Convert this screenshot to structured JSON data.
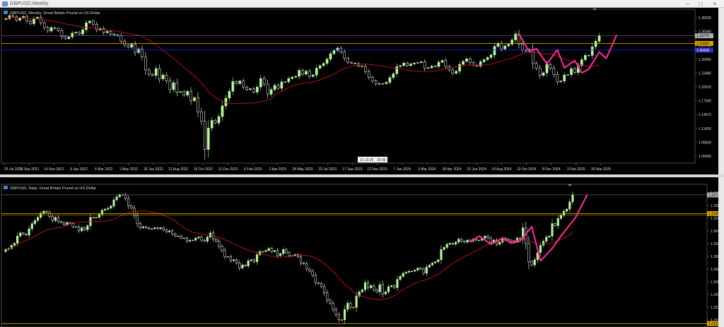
{
  "app": {
    "top_window_title": "GBPUSD,Weekly",
    "bottom_window_title": "GBPUSD,Daily"
  },
  "colors": {
    "background": "#000000",
    "bull_candle": "#b8f5a2",
    "bear_candle": "#ffffff",
    "moving_average": "#c01818",
    "annotation": "#e8308c",
    "h_line": "#d4a000",
    "bid_line": "#2020d8"
  },
  "chart_data": [
    {
      "type": "candlestick",
      "title": "GBPUSD, Weekly:  Great Britain Pound vs US Dollar",
      "x_ticks": [
        "25 Jul 2021",
        "19 Sep 2021",
        "14 Nov 2021",
        "9 Jan 2022",
        "6 Mar 2022",
        "1 May 2022",
        "26 Jun 2022",
        "21 Aug 2022",
        "16 Oct 2022",
        "11 Dec 2022",
        "5 Feb 2023",
        "2 Apr 2023",
        "28 May 2023",
        "23 Jul 2023",
        "17 Sep 2023",
        "12 Nov 2023",
        "7 Jan 2024",
        "3 Mar 2024",
        "28 Apr 2024",
        "23 Jun 2024",
        "18 Aug 2024",
        "13 Oct 2024",
        "8 Dec 2024",
        "2 Feb 2025",
        "30 Mar 2025"
      ],
      "y_ticks": [
        "1.38330",
        "1.35360",
        "1.29450",
        "1.26450",
        "1.23480",
        "1.20510",
        "1.17540",
        "1.14570",
        "1.11600",
        "1.08630",
        "1.05660"
      ],
      "price_labels": {
        "current": "1.33776",
        "h_line": "1.32005",
        "bid": "1.30426"
      },
      "cursor_label": {
        "date": "21.10.20",
        "time": "20:00"
      },
      "ylim": [
        1.04,
        1.4
      ],
      "ma_period": "",
      "closes": [
        1.378,
        1.385,
        1.382,
        1.374,
        1.379,
        1.383,
        1.372,
        1.366,
        1.378,
        1.381,
        1.368,
        1.357,
        1.349,
        1.357,
        1.355,
        1.35,
        1.336,
        1.331,
        1.335,
        1.344,
        1.346,
        1.342,
        1.352,
        1.368,
        1.372,
        1.365,
        1.352,
        1.355,
        1.345,
        1.348,
        1.342,
        1.34,
        1.338,
        1.325,
        1.316,
        1.311,
        1.318,
        1.299,
        1.307,
        1.288,
        1.258,
        1.248,
        1.245,
        1.261,
        1.237,
        1.246,
        1.232,
        1.212,
        1.228,
        1.206,
        1.207,
        1.199,
        1.208,
        1.186,
        1.193,
        1.16,
        1.138,
        1.072,
        1.122,
        1.14,
        1.134,
        1.149,
        1.174,
        1.192,
        1.208,
        1.231,
        1.226,
        1.232,
        1.218,
        1.212,
        1.214,
        1.206,
        1.218,
        1.238,
        1.225,
        1.201,
        1.212,
        1.222,
        1.215,
        1.23,
        1.23,
        1.238,
        1.241,
        1.243,
        1.257,
        1.248,
        1.255,
        1.243,
        1.246,
        1.262,
        1.268,
        1.273,
        1.283,
        1.296,
        1.303,
        1.309,
        1.3,
        1.285,
        1.276,
        1.274,
        1.273,
        1.267,
        1.267,
        1.254,
        1.241,
        1.232,
        1.225,
        1.226,
        1.226,
        1.229,
        1.24,
        1.249,
        1.266,
        1.268,
        1.274,
        1.268,
        1.272,
        1.274,
        1.275,
        1.277,
        1.262,
        1.263,
        1.267,
        1.266,
        1.276,
        1.28,
        1.266,
        1.258,
        1.25,
        1.255,
        1.271,
        1.278,
        1.284,
        1.275,
        1.269,
        1.267,
        1.277,
        1.282,
        1.287,
        1.293,
        1.313,
        1.32,
        1.307,
        1.314,
        1.318,
        1.328,
        1.342,
        1.318,
        1.305,
        1.302,
        1.306,
        1.273,
        1.262,
        1.245,
        1.251,
        1.271,
        1.262,
        1.247,
        1.23,
        1.232,
        1.246,
        1.247,
        1.261,
        1.252,
        1.268,
        1.282,
        1.292,
        1.292,
        1.312,
        1.325,
        1.338
      ]
    },
    {
      "type": "candlestick",
      "title": "GBPUSD, Daily:  Great Britain Pound vs US Dollar",
      "y_ticks": [
        "1.34078",
        "1.32868",
        "1.31698",
        "1.30440",
        "1.29230",
        "1.28020",
        "1.26810",
        "1.25600",
        "1.24390",
        "1.23100",
        "1.21970"
      ],
      "price_labels": {
        "current": "1.33776",
        "h_line_top": "1.31968",
        "h_line_bottom": "1.21329"
      },
      "ylim": [
        1.21,
        1.348
      ],
      "closes": [
        1.285,
        1.286,
        1.289,
        1.291,
        1.298,
        1.301,
        1.3,
        1.299,
        1.305,
        1.31,
        1.313,
        1.316,
        1.32,
        1.322,
        1.321,
        1.317,
        1.313,
        1.316,
        1.312,
        1.311,
        1.309,
        1.311,
        1.31,
        1.307,
        1.307,
        1.303,
        1.306,
        1.304,
        1.308,
        1.316,
        1.316,
        1.316,
        1.319,
        1.323,
        1.324,
        1.325,
        1.327,
        1.333,
        1.336,
        1.338,
        1.338,
        1.334,
        1.327,
        1.325,
        1.318,
        1.31,
        1.306,
        1.307,
        1.306,
        1.305,
        1.305,
        1.306,
        1.305,
        1.306,
        1.304,
        1.302,
        1.303,
        1.3,
        1.298,
        1.298,
        1.296,
        1.296,
        1.293,
        1.294,
        1.294,
        1.296,
        1.297,
        1.294,
        1.293,
        1.297,
        1.301,
        1.295,
        1.293,
        1.288,
        1.284,
        1.278,
        1.278,
        1.274,
        1.275,
        1.272,
        1.267,
        1.27,
        1.269,
        1.274,
        1.275,
        1.273,
        1.28,
        1.283,
        1.283,
        1.284,
        1.286,
        1.283,
        1.284,
        1.279,
        1.281,
        1.285,
        1.282,
        1.279,
        1.279,
        1.28,
        1.278,
        1.272,
        1.271,
        1.266,
        1.264,
        1.26,
        1.253,
        1.252,
        1.249,
        1.243,
        1.236,
        1.233,
        1.227,
        1.222,
        1.217,
        1.217,
        1.227,
        1.233,
        1.229,
        1.229,
        1.24,
        1.244,
        1.246,
        1.253,
        1.248,
        1.25,
        1.246,
        1.244,
        1.251,
        1.242,
        1.244,
        1.249,
        1.25,
        1.248,
        1.256,
        1.259,
        1.262,
        1.263,
        1.264,
        1.264,
        1.265,
        1.267,
        1.266,
        1.262,
        1.268,
        1.27,
        1.272,
        1.273,
        1.275,
        1.285,
        1.287,
        1.29,
        1.291,
        1.29,
        1.292,
        1.295,
        1.293,
        1.292,
        1.294,
        1.293,
        1.295,
        1.294,
        1.294,
        1.296,
        1.298,
        1.296,
        1.292,
        1.294,
        1.29,
        1.292,
        1.296,
        1.295,
        1.294,
        1.293,
        1.293,
        1.296,
        1.295,
        1.306,
        1.291,
        1.273,
        1.27,
        1.275,
        1.282,
        1.289,
        1.293,
        1.297,
        1.298,
        1.31,
        1.308,
        1.315,
        1.318,
        1.322,
        1.324,
        1.331,
        1.338
      ]
    }
  ]
}
